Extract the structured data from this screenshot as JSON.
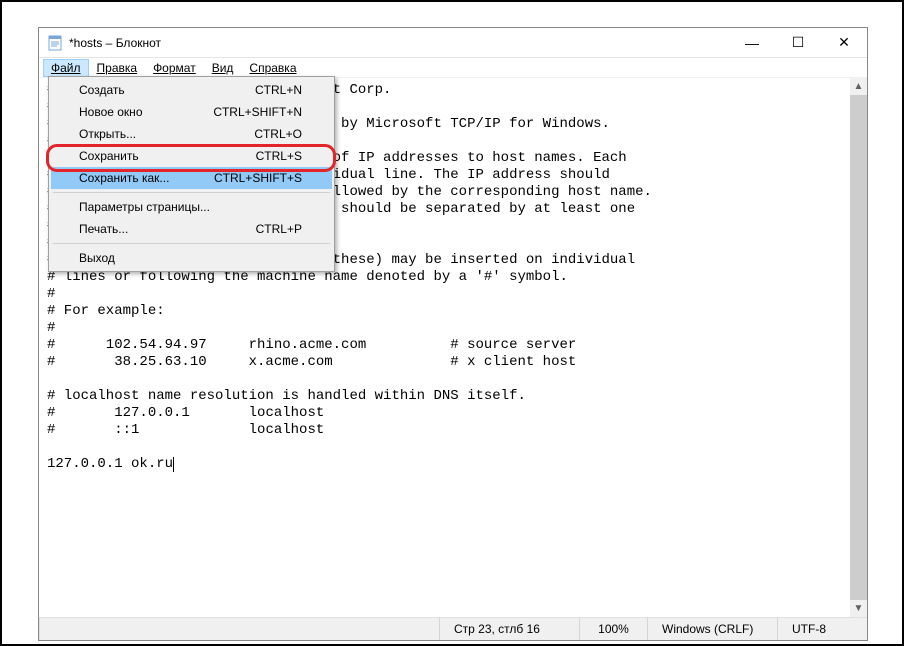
{
  "window": {
    "title": "*hosts – Блокнот",
    "controls": {
      "min": "—",
      "max": "☐",
      "close": "✕"
    }
  },
  "menubar": {
    "file": {
      "label": "Файл",
      "underline": "Ф"
    },
    "edit": {
      "label": "Правка",
      "underline": "П"
    },
    "format": {
      "label": "Формат",
      "underline": "о"
    },
    "view": {
      "label": "Вид",
      "underline": "В"
    },
    "help": {
      "label": "Справка",
      "underline": "С"
    }
  },
  "file_menu": {
    "items": [
      {
        "label": "Создать",
        "shortcut": "CTRL+N"
      },
      {
        "label": "Новое окно",
        "shortcut": "CTRL+SHIFT+N"
      },
      {
        "label": "Открыть...",
        "shortcut": "CTRL+O"
      },
      {
        "label": "Сохранить",
        "shortcut": "CTRL+S"
      },
      {
        "label": "Сохранить как...",
        "shortcut": "CTRL+SHIFT+S"
      }
    ],
    "items2": [
      {
        "label": "Параметры страницы...",
        "shortcut": ""
      },
      {
        "label": "Печать...",
        "shortcut": "CTRL+P"
      }
    ],
    "items3": [
      {
        "label": "Выход",
        "shortcut": ""
      }
    ]
  },
  "editor": {
    "text": "# Copyright (c) 1993-2009 Microsoft Corp.\n#\n# This is a sample HOSTS file used by Microsoft TCP/IP for Windows.\n#\n# This file contains the mappings of IP addresses to host names. Each\n# entry should be kept on an individual line. The IP address should\n# be placed in the first column followed by the corresponding host name.\n# The IP address and the host name should be separated by at least one\n# space.\n#\n# Additionally, comments (such as these) may be inserted on individual\n# lines or following the machine name denoted by a '#' symbol.\n#\n# For example:\n#\n#      102.54.94.97     rhino.acme.com          # source server\n#       38.25.63.10     x.acme.com              # x client host\n\n# localhost name resolution is handled within DNS itself.\n#\t127.0.0.1       localhost\n#\t::1             localhost\n\n127.0.0.1 ok.ru"
  },
  "status": {
    "position": "Стр 23, стлб 16",
    "zoom": "100%",
    "encoding": "Windows (CRLF)",
    "format": "UTF-8"
  }
}
